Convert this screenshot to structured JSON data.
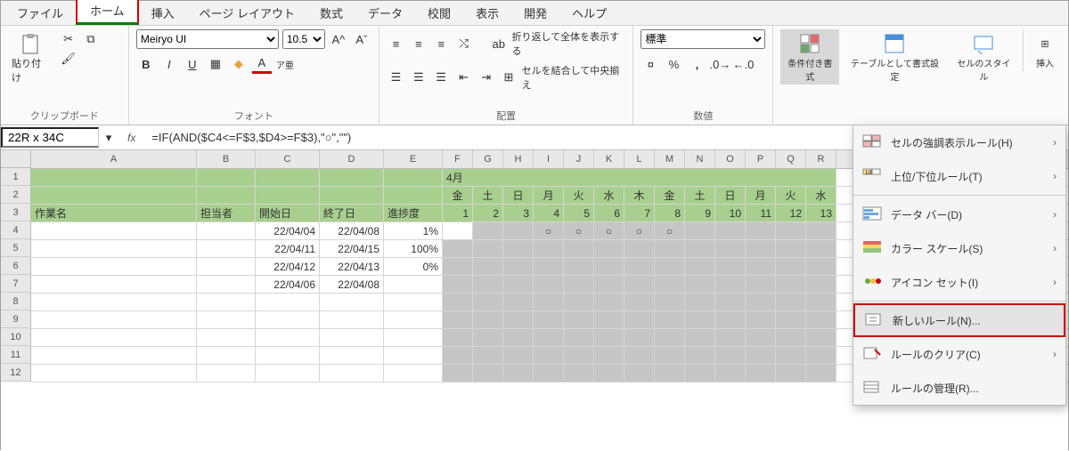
{
  "tabs": {
    "file": "ファイル",
    "home": "ホーム",
    "insert": "挿入",
    "pagelayout": "ページ レイアウト",
    "formulas": "数式",
    "data": "データ",
    "review": "校閲",
    "view": "表示",
    "developer": "開発",
    "help": "ヘルプ"
  },
  "ribbon": {
    "clipboard": {
      "label": "クリップボード",
      "paste": "貼り付け"
    },
    "font": {
      "label": "フォント",
      "name": "Meiryo UI",
      "size": "10.5"
    },
    "align": {
      "label": "配置",
      "wrap": "折り返して全体を表示する",
      "merge": "セルを結合して中央揃え"
    },
    "number": {
      "label": "数値",
      "format": "標準"
    },
    "styles": {
      "cond": "条件付き書式",
      "table": "テーブルとして書式設定",
      "cell": "セルのスタイル"
    },
    "insert": "挿入"
  },
  "name_box": "22R x 34C",
  "formula": "=IF(AND($C4<=F$3,$D4>=F$3),\"○\",\"\")",
  "cols": [
    "A",
    "B",
    "C",
    "D",
    "E",
    "F",
    "G",
    "H",
    "I",
    "J",
    "K",
    "L",
    "M",
    "N",
    "O",
    "P",
    "Q",
    "R"
  ],
  "hdr1": {
    "month": "4月"
  },
  "hdr2_days": [
    "金",
    "土",
    "日",
    "月",
    "火",
    "水",
    "木",
    "金",
    "土",
    "日",
    "月",
    "火",
    "水"
  ],
  "hdr3": {
    "A": "作業名",
    "B": "担当者",
    "C": "開始日",
    "D": "終了日",
    "E": "進捗度"
  },
  "hdr3_nums": [
    "1",
    "2",
    "3",
    "4",
    "5",
    "6",
    "7",
    "8",
    "9",
    "10",
    "11",
    "12",
    "13"
  ],
  "rows": {
    "r4": {
      "C": "22/04/04",
      "D": "22/04/08",
      "E": "1%",
      "marks": [
        false,
        false,
        false,
        true,
        true,
        true,
        true,
        true,
        false,
        false,
        false,
        false,
        false
      ]
    },
    "r5": {
      "C": "22/04/11",
      "D": "22/04/15",
      "E": "100%"
    },
    "r6": {
      "C": "22/04/12",
      "D": "22/04/13",
      "E": "0%"
    },
    "r7": {
      "C": "22/04/06",
      "D": "22/04/08",
      "E": ""
    }
  },
  "dropdown": {
    "highlight": "セルの強調表示ルール(H)",
    "top": "上位/下位ルール(T)",
    "databar": "データ バー(D)",
    "colorscale": "カラー スケール(S)",
    "iconset": "アイコン セット(I)",
    "newrule": "新しいルール(N)...",
    "clear": "ルールのクリア(C)",
    "manage": "ルールの管理(R)..."
  },
  "chart_data": null
}
